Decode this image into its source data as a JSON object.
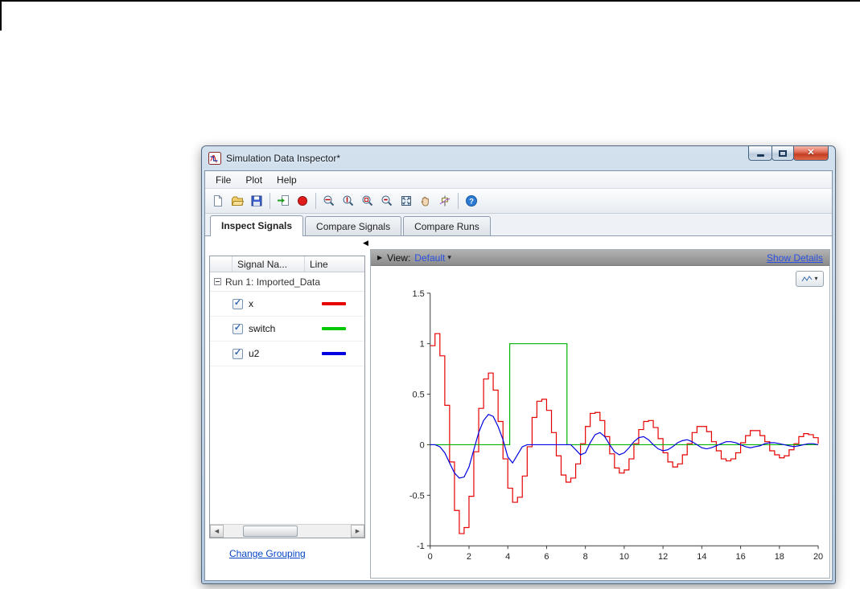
{
  "window": {
    "title": "Simulation Data Inspector*",
    "menu": {
      "items": [
        {
          "label": "File"
        },
        {
          "label": "Plot"
        },
        {
          "label": "Help"
        }
      ]
    },
    "toolbar": {
      "items": [
        {
          "icon": "new-file-icon"
        },
        {
          "icon": "open-file-icon"
        },
        {
          "icon": "save-icon"
        },
        {
          "icon": "import-data-icon"
        },
        {
          "icon": "record-icon"
        },
        {
          "icon": "zoom-in-x-icon"
        },
        {
          "icon": "zoom-in-y-icon"
        },
        {
          "icon": "zoom-box-icon"
        },
        {
          "icon": "zoom-out-icon"
        },
        {
          "icon": "fit-to-view-icon"
        },
        {
          "icon": "pan-icon"
        },
        {
          "icon": "data-cursor-icon"
        },
        {
          "icon": "help-icon"
        }
      ]
    },
    "tabs": {
      "items": [
        {
          "label": "Inspect Signals",
          "active": true
        },
        {
          "label": "Compare Signals",
          "active": false
        },
        {
          "label": "Compare Runs",
          "active": false
        }
      ]
    },
    "signals": {
      "columns": [
        {
          "label": "Signal Na..."
        },
        {
          "label": "Line"
        }
      ],
      "group_label": "Run 1: Imported_Data",
      "rows": [
        {
          "name": "x",
          "checked": true,
          "color": "#e60000"
        },
        {
          "name": "switch",
          "checked": true,
          "color": "#00c800"
        },
        {
          "name": "u2",
          "checked": true,
          "color": "#0000e0"
        }
      ],
      "footer_link": "Change Grouping"
    },
    "view_bar": {
      "label": "View:",
      "value": "Default",
      "details_link": "Show Details"
    }
  },
  "chart_data": {
    "type": "line",
    "title": "",
    "xlabel": "",
    "ylabel": "",
    "xlim": [
      0,
      20
    ],
    "ylim": [
      -1,
      1.5
    ],
    "xticks": [
      0,
      2,
      4,
      6,
      8,
      10,
      12,
      14,
      16,
      18,
      20
    ],
    "yticks": [
      -1,
      -0.5,
      0,
      0.5,
      1,
      1.5
    ],
    "grid": false,
    "legend": "none",
    "series": [
      {
        "name": "x",
        "color": "#e60000",
        "interp": "step",
        "t0": 0,
        "dt": 0.25,
        "values": [
          0.98,
          1.1,
          0.88,
          0.39,
          -0.17,
          -0.65,
          -0.88,
          -0.82,
          -0.51,
          -0.07,
          0.36,
          0.65,
          0.71,
          0.54,
          0.23,
          -0.14,
          -0.43,
          -0.57,
          -0.52,
          -0.31,
          -0.02,
          0.27,
          0.43,
          0.45,
          0.34,
          0.12,
          -0.11,
          -0.3,
          -0.37,
          -0.33,
          -0.19,
          0.01,
          0.18,
          0.31,
          0.32,
          0.24,
          0.08,
          -0.09,
          -0.23,
          -0.28,
          -0.25,
          -0.14,
          0.01,
          0.15,
          0.23,
          0.24,
          0.17,
          0.06,
          -0.08,
          -0.17,
          -0.22,
          -0.19,
          -0.1,
          0.01,
          0.12,
          0.18,
          0.18,
          0.13,
          0.03,
          -0.06,
          -0.14,
          -0.16,
          -0.14,
          -0.08,
          0.02,
          0.09,
          0.14,
          0.14,
          0.09,
          0.03,
          -0.06,
          -0.1,
          -0.13,
          -0.11,
          -0.05,
          0.01,
          0.08,
          0.11,
          0.1,
          0.07,
          0.01
        ]
      },
      {
        "name": "switch",
        "color": "#00b400",
        "interp": "linear",
        "points": [
          [
            0,
            0
          ],
          [
            4.1,
            0
          ],
          [
            4.1,
            1
          ],
          [
            7.05,
            1
          ],
          [
            7.05,
            0
          ],
          [
            20,
            0
          ]
        ]
      },
      {
        "name": "u2",
        "color": "#0000e0",
        "interp": "linear",
        "t0": 0,
        "dt": 0.25,
        "values": [
          0.0,
          0.0,
          -0.02,
          -0.08,
          -0.18,
          -0.28,
          -0.33,
          -0.32,
          -0.22,
          -0.05,
          0.12,
          0.24,
          0.3,
          0.28,
          0.18,
          0.05,
          -0.12,
          -0.18,
          -0.1,
          -0.02,
          0.0,
          0.0,
          0.0,
          0.0,
          0.0,
          0.0,
          0.0,
          0.0,
          0.0,
          0.0,
          -0.05,
          -0.1,
          -0.08,
          0.02,
          0.1,
          0.12,
          0.08,
          0.0,
          -0.07,
          -0.1,
          -0.08,
          -0.03,
          0.03,
          0.07,
          0.08,
          0.05,
          0.0,
          -0.04,
          -0.06,
          -0.05,
          -0.02,
          0.02,
          0.04,
          0.05,
          0.03,
          0.0,
          -0.03,
          -0.04,
          -0.03,
          -0.01,
          0.01,
          0.03,
          0.03,
          0.02,
          0.0,
          -0.02,
          -0.03,
          -0.02,
          -0.01,
          0.01,
          0.02,
          0.02,
          0.01,
          0.0,
          -0.01,
          -0.02,
          -0.01,
          0.0,
          0.01,
          0.01,
          0.0
        ]
      }
    ]
  }
}
